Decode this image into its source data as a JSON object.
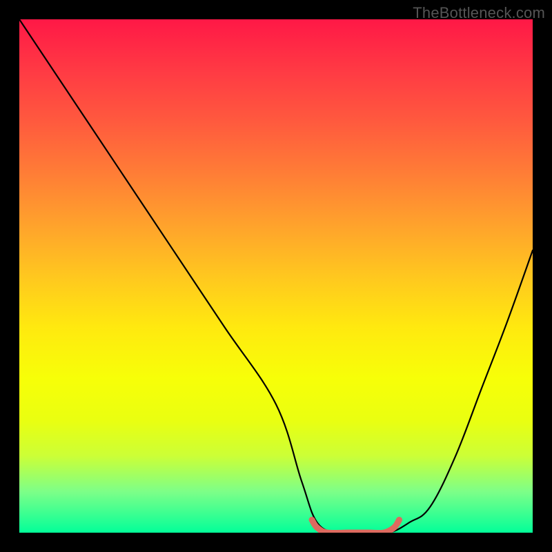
{
  "watermark": "TheBottleneck.com",
  "chart_data": {
    "type": "line",
    "title": "",
    "xlabel": "",
    "ylabel": "",
    "xlim": [
      0,
      100
    ],
    "ylim": [
      0,
      100
    ],
    "grid": false,
    "background_gradient": {
      "top_color": "#ff1846",
      "middle_color": "#ffe90f",
      "bottom_color": "#03ff99"
    },
    "notes": "Axes unlabeled; vertical position encodes bottleneck severity (top = worst, bottom = optimal). Values below are estimated from curve pixel positions on a 0–100 normalized scale for each axis.",
    "series": [
      {
        "name": "main-curve",
        "color": "#000000",
        "x": [
          0,
          10,
          20,
          30,
          40,
          50,
          55,
          58,
          62,
          67,
          72,
          76,
          80,
          85,
          90,
          95,
          100
        ],
        "values": [
          100,
          85,
          70,
          55,
          40,
          25,
          10,
          2,
          0,
          0,
          0,
          2,
          5,
          15,
          28,
          41,
          55
        ]
      },
      {
        "name": "optimal-marker",
        "color": "#dd6a5f",
        "x": [
          57,
          58,
          60,
          64,
          68,
          71,
          73,
          74
        ],
        "values": [
          2.5,
          1.0,
          0.0,
          0.0,
          0.0,
          0.0,
          1.0,
          2.5
        ]
      }
    ]
  }
}
